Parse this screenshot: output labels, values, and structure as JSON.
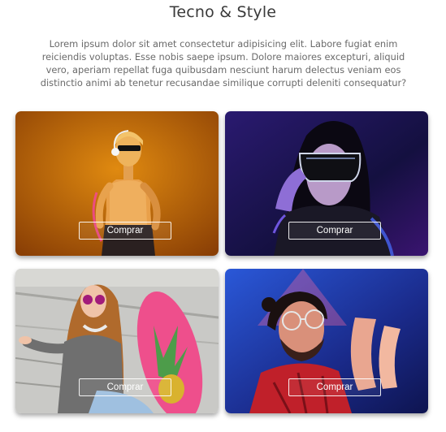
{
  "header": {
    "title": "Tecno & Style",
    "description": "Lorem ipsum dolor sit amet consectetur adipisicing elit. Labore fugiat enim reiciendis voluptas. Esse nobis saepe ipsum. Dolore maiores excepturi, aliquid vero, aperiam repellat fuga quibusdam nesciunt harum delectus veniam eos distinctio animi ab tenetur recusandae similique corrupti deleniti consequatur?"
  },
  "cards": [
    {
      "button_label": "Comprar"
    },
    {
      "button_label": "Comprar"
    },
    {
      "button_label": "Comprar"
    },
    {
      "button_label": "Comprar"
    }
  ],
  "colors": {
    "card1_background": "#c46a08",
    "card2_background": "#1c1648",
    "card3_background": "#b9b9b9",
    "card4_background": "#1d3aa8",
    "title_text": "#3a3a3a",
    "body_text": "#6a6a6a"
  }
}
